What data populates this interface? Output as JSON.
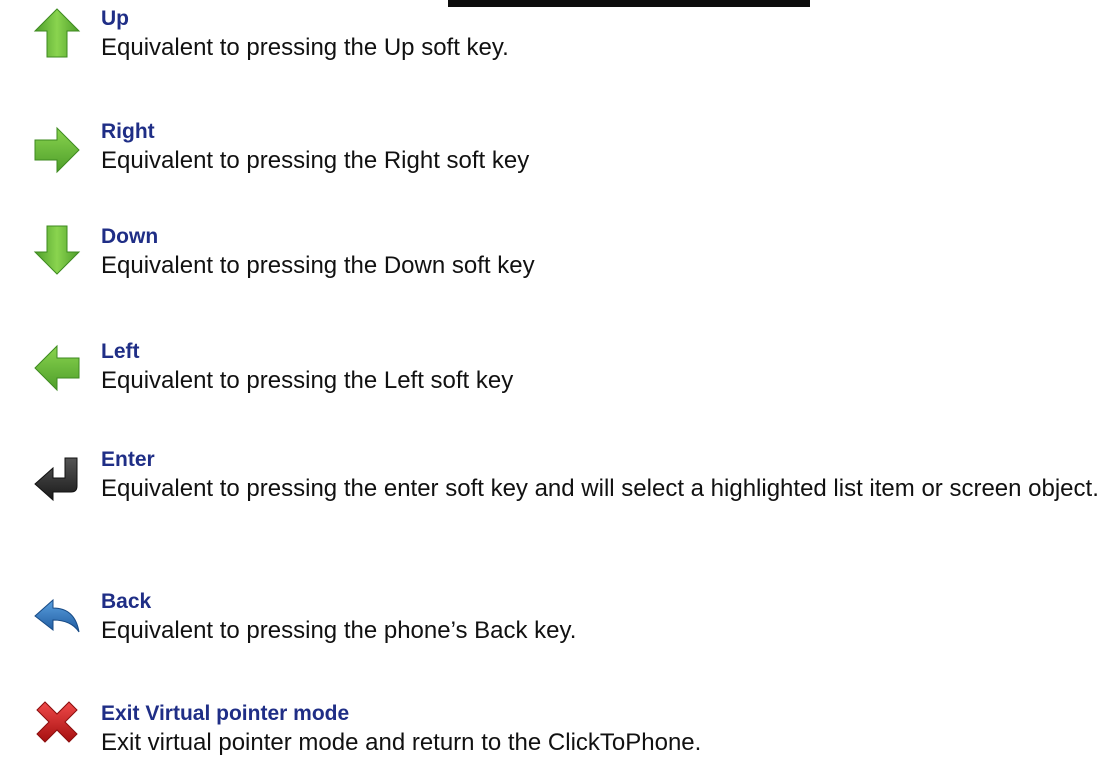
{
  "entries": [
    {
      "icon": "up-arrow-icon",
      "title": "Up",
      "description": "Equivalent to pressing the Up soft key."
    },
    {
      "icon": "right-arrow-icon",
      "title": "Right",
      "description": "Equivalent to pressing the Right soft key"
    },
    {
      "icon": "down-arrow-icon",
      "title": "Down",
      "description": "Equivalent to pressing the Down soft key"
    },
    {
      "icon": "left-arrow-icon",
      "title": "Left",
      "description": "Equivalent to pressing the Left soft key"
    },
    {
      "icon": "enter-icon",
      "title": "Enter",
      "description": "Equivalent to pressing the enter soft key and will select a highlighted list item or screen object."
    },
    {
      "icon": "back-icon",
      "title": "Back",
      "description": "Equivalent to pressing the phone’s Back key."
    },
    {
      "icon": "close-x-icon",
      "title": "Exit Virtual pointer mode",
      "description": "Exit virtual pointer mode and return to the ClickToPhone."
    }
  ],
  "colors": {
    "title": "#1f2e86",
    "text": "#111111",
    "arrow_green": "#6cbf3a",
    "enter_dark": "#2b2b2b",
    "back_blue": "#2f6fb5",
    "exit_red": "#d21f1f"
  }
}
